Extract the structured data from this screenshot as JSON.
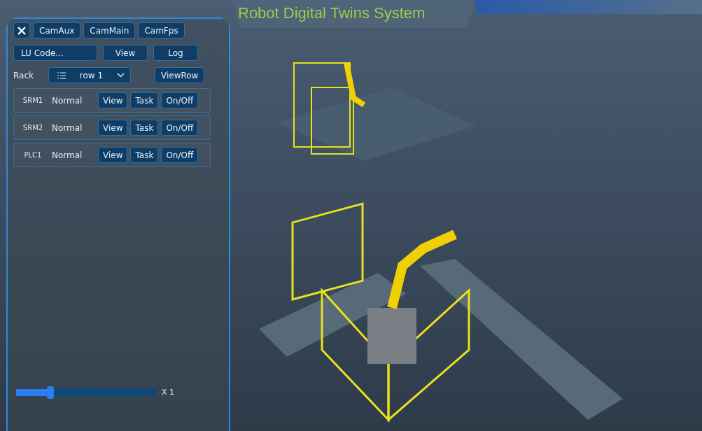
{
  "title": "Robot Digital Twins System",
  "camera_buttons": [
    "CamAux",
    "CamMain",
    "CamFps"
  ],
  "lu_code": {
    "placeholder": "LU Code...",
    "buttons": [
      "View",
      "Log"
    ]
  },
  "rack": {
    "label": "Rack",
    "value": "row 1",
    "button": "ViewRow"
  },
  "devices": [
    {
      "name": "SRM1",
      "status": "Normal",
      "buttons": [
        "View",
        "Task",
        "On/Off"
      ]
    },
    {
      "name": "SRM2",
      "status": "Normal",
      "buttons": [
        "View",
        "Task",
        "On/Off"
      ]
    },
    {
      "name": "PLC1",
      "status": "Normal",
      "buttons": [
        "View",
        "Task",
        "On/Off"
      ]
    }
  ],
  "speed": {
    "level": 0.22,
    "reading": "X 1"
  }
}
